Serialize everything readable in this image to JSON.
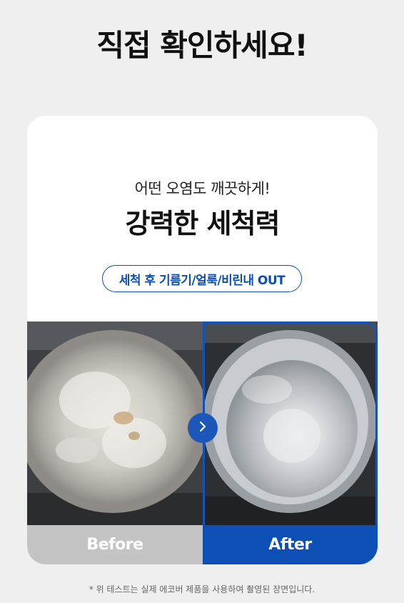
{
  "header": {
    "title": "직접 확인하세요!"
  },
  "card": {
    "subtitle": "어떤 오염도 깨끗하게!",
    "headline": "강력한 세척력",
    "pill": "세척 후 기름기/얼룩/비린내 OUT"
  },
  "comparison": {
    "before_label": "Before",
    "after_label": "After",
    "next_icon": "chevron-right-icon"
  },
  "colors": {
    "accent": "#0d4fb5",
    "before_bar": "#c4c4c4",
    "background": "#efefef"
  },
  "footnote": "* 위 테스트는 실제 에코버 제품을 사용하여 촬영된 장면입니다."
}
